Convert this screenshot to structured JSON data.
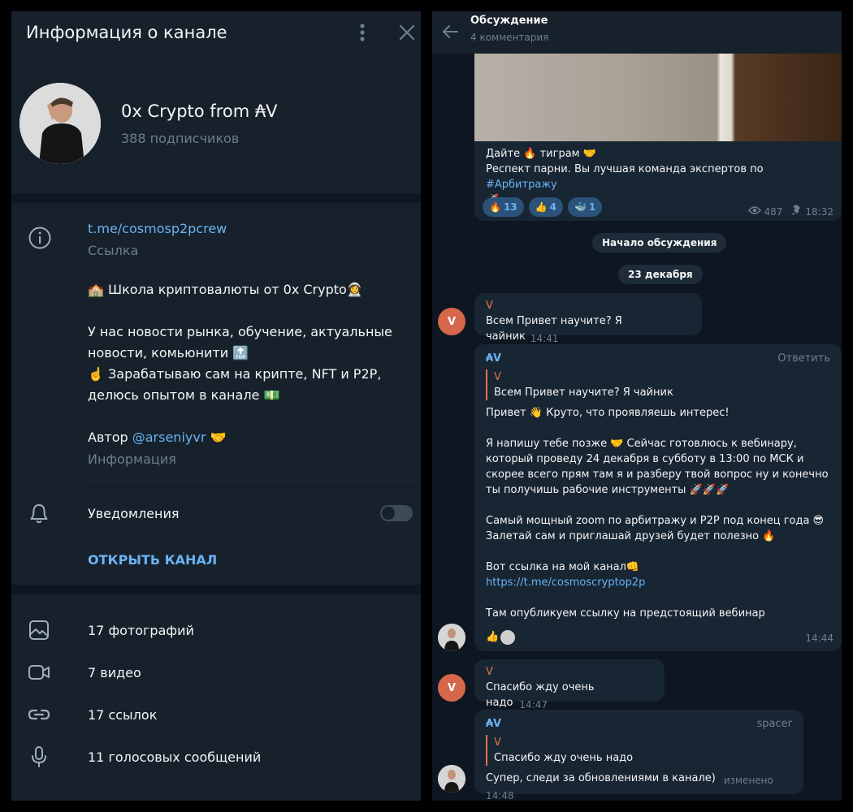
{
  "channel_info": {
    "header_title": "Информация о канале",
    "name": "0x Crypto from ₳V",
    "subscribers": "388 подписчиков",
    "link": "t.me/cosmosp2pcrew",
    "link_label": "Ссылка",
    "description_1": "🏫 Школа криптовалюты от 0x Crypto👩‍🚀",
    "description_2a": "У нас новости рынка, обучение, актуальные новости, комьюнити 🔝",
    "description_2b": "☝️ Зарабатываю сам на крипте, NFT и P2P, делюсь опытом в канале 💵",
    "author_prefix": "Автор ",
    "author_mention": "@arseniyvr",
    "author_suffix": " 🤝",
    "info_label": "Информация",
    "notifications_label": "Уведомления",
    "open_channel_label": "ОТКРЫТЬ КАНАЛ",
    "media": [
      {
        "icon": "photo-icon",
        "label": "17 фотографий"
      },
      {
        "icon": "video-icon",
        "label": "7 видео"
      },
      {
        "icon": "link-icon",
        "label": "17 ссылок"
      },
      {
        "icon": "microphone-icon",
        "label": "11 голосовых сообщений"
      }
    ]
  },
  "discussion": {
    "title": "Обсуждение",
    "subtitle": "4 комментария",
    "post": {
      "line1": "Дайте 🔥 тиграм 🤝",
      "line2_prefix": "Респект парни. Вы лучшая команда экспертов по ",
      "line2_hashtag": "#Арбитражу",
      "line3": "🚀",
      "reactions": [
        {
          "emoji": "🔥",
          "count": "13"
        },
        {
          "emoji": "👍",
          "count": "4"
        },
        {
          "emoji": "🐳",
          "count": "1"
        }
      ],
      "views": "487",
      "time": "18:32"
    },
    "system_start": "Начало обсуждения",
    "date": "23 декабря",
    "messages": [
      {
        "avatar_letter": "V",
        "sender": "V",
        "text": "Всем Привет научите? Я чайник",
        "time": "14:41"
      },
      {
        "sender": "₳V",
        "reply_action": "Ответить",
        "quote_sender": "V",
        "quote_text": "Всем Привет научите? Я чайник",
        "p1": "Привет 👋 Круто, что проявляешь интерес!",
        "p2": "Я напишу тебе позже 🤝 Сейчас готовлюсь к вебинару, который проведу 24 декабря в субботу в 13:00 по МСК и скорее всего прям там я и разберу твой вопрос ну и конечно ты получишь рабочие инструменты 🚀🚀🚀",
        "p3": "Самый мощный zoom по арбитражу и P2P под конец года 😎 Залетай сам и приглашай друзей будет полезно 🔥",
        "p4": "Вот ссылка на мой канал👊",
        "p4_link": "https://t.me/cosmoscryptop2p",
        "p5": "Там опубликуем ссылку на предстоящий вебинар",
        "reaction": "👍",
        "time": "14:44"
      },
      {
        "avatar_letter": "V",
        "sender": "V",
        "text": "Спасибо жду очень надо",
        "time": "14:47"
      },
      {
        "sender": "₳V",
        "badge": "spacer",
        "quote_sender": "V",
        "quote_text": "Спасибо жду очень надо",
        "text": "Супер, следи за обновлениями в канале)",
        "time": "изменено 14:48"
      }
    ]
  }
}
